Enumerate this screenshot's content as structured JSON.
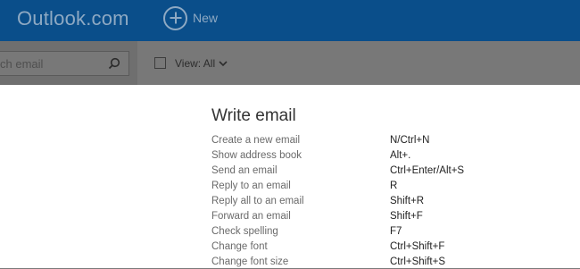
{
  "header": {
    "brand": "Outlook.com",
    "new_label": "New",
    "brand_color": "#0a4e8a"
  },
  "toolbar": {
    "search_placeholder": "ch email",
    "view_label": "View: All"
  },
  "dialog": {
    "title": "Write email",
    "shortcuts": [
      {
        "action": "Create a new email",
        "keys": "N/Ctrl+N"
      },
      {
        "action": "Show address book",
        "keys": "Alt+."
      },
      {
        "action": "Send an email",
        "keys": "Ctrl+Enter/Alt+S"
      },
      {
        "action": "Reply to an email",
        "keys": "R"
      },
      {
        "action": "Reply all to an email",
        "keys": "Shift+R"
      },
      {
        "action": "Forward an email",
        "keys": "Shift+F"
      },
      {
        "action": "Check spelling",
        "keys": "F7"
      },
      {
        "action": "Change font",
        "keys": "Ctrl+Shift+F"
      },
      {
        "action": "Change font size",
        "keys": "Ctrl+Shift+S"
      }
    ]
  }
}
